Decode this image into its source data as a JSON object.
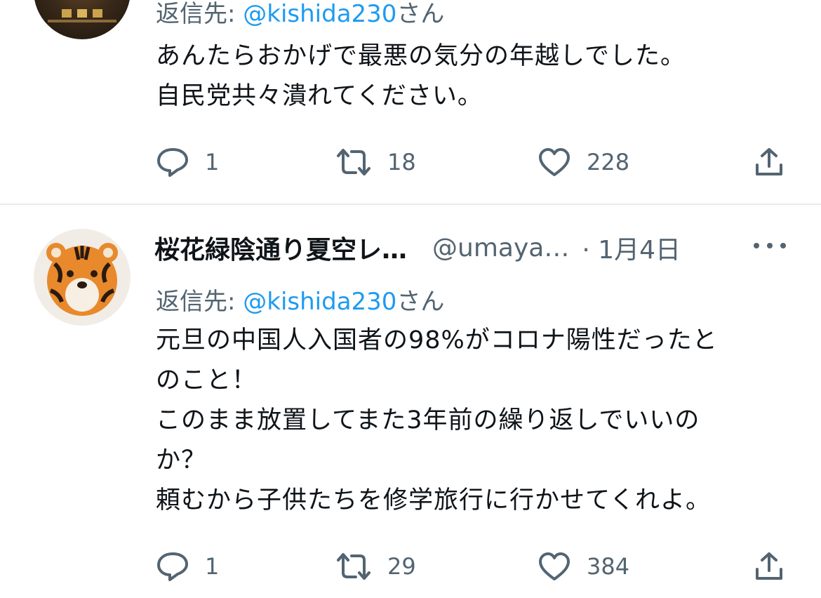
{
  "tweets": [
    {
      "reply_label": "返信先: ",
      "reply_mention": "@kishida230",
      "reply_suffix": "さん",
      "lines": [
        "あんたらおかげで最悪の気分の年越しでした。",
        "自民党共々潰れてください。"
      ],
      "replies": "1",
      "retweets": "18",
      "likes": "228"
    },
    {
      "name": "桜花緑陰通り夏空レ…",
      "handle": "@umaya…",
      "time": "· 1月4日",
      "reply_label": "返信先: ",
      "reply_mention": "@kishida230",
      "reply_suffix": "さん",
      "lines": [
        "元旦の中国人入国者の98%がコロナ陽性だったと",
        "のこと！",
        "このまま放置してまた3年前の繰り返しでいいの",
        "か？",
        "頼むから子供たちを修学旅行に行かせてくれよ。"
      ],
      "replies": "1",
      "retweets": "29",
      "likes": "384"
    }
  ],
  "colors": {
    "accent": "#1d9bf0",
    "secondary_text": "#536471",
    "text": "#0f1419",
    "divider": "#e6ecf0"
  },
  "icons": [
    "reply-icon",
    "retweet-icon",
    "like-icon",
    "share-icon",
    "more-icon"
  ]
}
